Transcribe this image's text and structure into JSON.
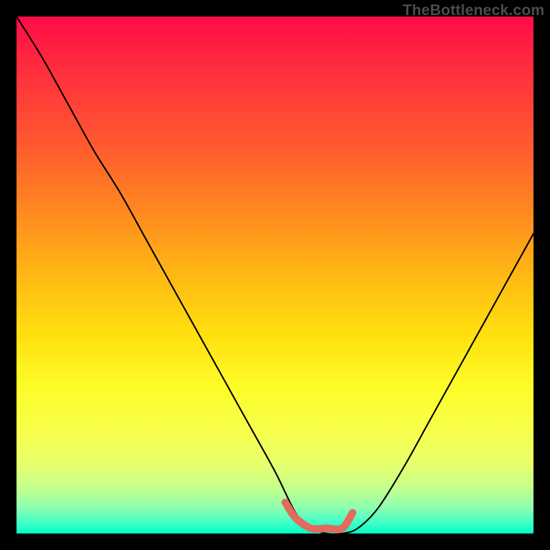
{
  "watermark": "TheBottleneck.com",
  "colors": {
    "frame": "#000000",
    "curve_stroke": "#000000",
    "highlight_stroke": "#e26a5f",
    "gradient_top": "#ff0b46",
    "gradient_bottom": "#00ffc0"
  },
  "chart_data": {
    "type": "line",
    "title": "",
    "xlabel": "",
    "ylabel": "",
    "xlim": [
      0,
      100
    ],
    "ylim": [
      0,
      100
    ],
    "grid": false,
    "legend": false,
    "annotations": [
      {
        "text": "TheBottleneck.com",
        "position": "top-right"
      }
    ],
    "series": [
      {
        "name": "bottleneck-curve",
        "x": [
          0,
          5,
          10,
          15,
          20,
          25,
          30,
          35,
          40,
          45,
          50,
          54,
          57,
          60,
          63,
          66,
          70,
          75,
          80,
          85,
          90,
          95,
          100
        ],
        "y": [
          100,
          92,
          83,
          74,
          66,
          57,
          48,
          39,
          30,
          21,
          12,
          4,
          1,
          0,
          0,
          1,
          5,
          13,
          22,
          31,
          40,
          49,
          58
        ]
      }
    ],
    "highlight_segment": {
      "name": "flat-bottom-marker",
      "x": [
        52,
        54,
        57,
        60,
        63,
        65
      ],
      "y": [
        6,
        3,
        1,
        1,
        1,
        4
      ]
    }
  }
}
